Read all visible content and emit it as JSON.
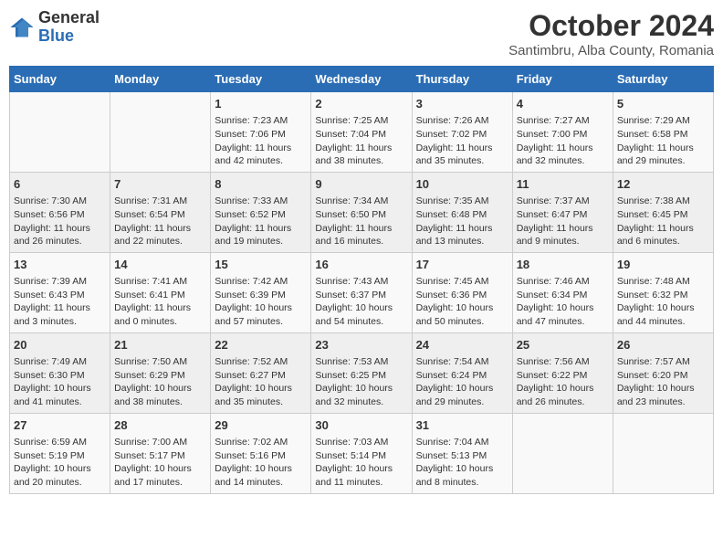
{
  "logo": {
    "general": "General",
    "blue": "Blue"
  },
  "title": "October 2024",
  "subtitle": "Santimbru, Alba County, Romania",
  "headers": [
    "Sunday",
    "Monday",
    "Tuesday",
    "Wednesday",
    "Thursday",
    "Friday",
    "Saturday"
  ],
  "weeks": [
    [
      {
        "day": "",
        "content": ""
      },
      {
        "day": "",
        "content": ""
      },
      {
        "day": "1",
        "content": "Sunrise: 7:23 AM\nSunset: 7:06 PM\nDaylight: 11 hours and 42 minutes."
      },
      {
        "day": "2",
        "content": "Sunrise: 7:25 AM\nSunset: 7:04 PM\nDaylight: 11 hours and 38 minutes."
      },
      {
        "day": "3",
        "content": "Sunrise: 7:26 AM\nSunset: 7:02 PM\nDaylight: 11 hours and 35 minutes."
      },
      {
        "day": "4",
        "content": "Sunrise: 7:27 AM\nSunset: 7:00 PM\nDaylight: 11 hours and 32 minutes."
      },
      {
        "day": "5",
        "content": "Sunrise: 7:29 AM\nSunset: 6:58 PM\nDaylight: 11 hours and 29 minutes."
      }
    ],
    [
      {
        "day": "6",
        "content": "Sunrise: 7:30 AM\nSunset: 6:56 PM\nDaylight: 11 hours and 26 minutes."
      },
      {
        "day": "7",
        "content": "Sunrise: 7:31 AM\nSunset: 6:54 PM\nDaylight: 11 hours and 22 minutes."
      },
      {
        "day": "8",
        "content": "Sunrise: 7:33 AM\nSunset: 6:52 PM\nDaylight: 11 hours and 19 minutes."
      },
      {
        "day": "9",
        "content": "Sunrise: 7:34 AM\nSunset: 6:50 PM\nDaylight: 11 hours and 16 minutes."
      },
      {
        "day": "10",
        "content": "Sunrise: 7:35 AM\nSunset: 6:48 PM\nDaylight: 11 hours and 13 minutes."
      },
      {
        "day": "11",
        "content": "Sunrise: 7:37 AM\nSunset: 6:47 PM\nDaylight: 11 hours and 9 minutes."
      },
      {
        "day": "12",
        "content": "Sunrise: 7:38 AM\nSunset: 6:45 PM\nDaylight: 11 hours and 6 minutes."
      }
    ],
    [
      {
        "day": "13",
        "content": "Sunrise: 7:39 AM\nSunset: 6:43 PM\nDaylight: 11 hours and 3 minutes."
      },
      {
        "day": "14",
        "content": "Sunrise: 7:41 AM\nSunset: 6:41 PM\nDaylight: 11 hours and 0 minutes."
      },
      {
        "day": "15",
        "content": "Sunrise: 7:42 AM\nSunset: 6:39 PM\nDaylight: 10 hours and 57 minutes."
      },
      {
        "day": "16",
        "content": "Sunrise: 7:43 AM\nSunset: 6:37 PM\nDaylight: 10 hours and 54 minutes."
      },
      {
        "day": "17",
        "content": "Sunrise: 7:45 AM\nSunset: 6:36 PM\nDaylight: 10 hours and 50 minutes."
      },
      {
        "day": "18",
        "content": "Sunrise: 7:46 AM\nSunset: 6:34 PM\nDaylight: 10 hours and 47 minutes."
      },
      {
        "day": "19",
        "content": "Sunrise: 7:48 AM\nSunset: 6:32 PM\nDaylight: 10 hours and 44 minutes."
      }
    ],
    [
      {
        "day": "20",
        "content": "Sunrise: 7:49 AM\nSunset: 6:30 PM\nDaylight: 10 hours and 41 minutes."
      },
      {
        "day": "21",
        "content": "Sunrise: 7:50 AM\nSunset: 6:29 PM\nDaylight: 10 hours and 38 minutes."
      },
      {
        "day": "22",
        "content": "Sunrise: 7:52 AM\nSunset: 6:27 PM\nDaylight: 10 hours and 35 minutes."
      },
      {
        "day": "23",
        "content": "Sunrise: 7:53 AM\nSunset: 6:25 PM\nDaylight: 10 hours and 32 minutes."
      },
      {
        "day": "24",
        "content": "Sunrise: 7:54 AM\nSunset: 6:24 PM\nDaylight: 10 hours and 29 minutes."
      },
      {
        "day": "25",
        "content": "Sunrise: 7:56 AM\nSunset: 6:22 PM\nDaylight: 10 hours and 26 minutes."
      },
      {
        "day": "26",
        "content": "Sunrise: 7:57 AM\nSunset: 6:20 PM\nDaylight: 10 hours and 23 minutes."
      }
    ],
    [
      {
        "day": "27",
        "content": "Sunrise: 6:59 AM\nSunset: 5:19 PM\nDaylight: 10 hours and 20 minutes."
      },
      {
        "day": "28",
        "content": "Sunrise: 7:00 AM\nSunset: 5:17 PM\nDaylight: 10 hours and 17 minutes."
      },
      {
        "day": "29",
        "content": "Sunrise: 7:02 AM\nSunset: 5:16 PM\nDaylight: 10 hours and 14 minutes."
      },
      {
        "day": "30",
        "content": "Sunrise: 7:03 AM\nSunset: 5:14 PM\nDaylight: 10 hours and 11 minutes."
      },
      {
        "day": "31",
        "content": "Sunrise: 7:04 AM\nSunset: 5:13 PM\nDaylight: 10 hours and 8 minutes."
      },
      {
        "day": "",
        "content": ""
      },
      {
        "day": "",
        "content": ""
      }
    ]
  ]
}
